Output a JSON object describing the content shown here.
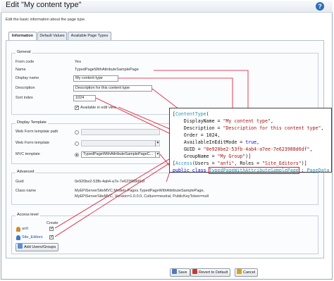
{
  "header": {
    "title": "Edit \"My content type\"",
    "help_icon": "?",
    "description": "Edit the basic information about the page type."
  },
  "tabs": [
    {
      "label": "Information",
      "active": true
    },
    {
      "label": "Default Values",
      "active": false
    },
    {
      "label": "Available Page Types",
      "active": false
    }
  ],
  "general": {
    "legend": "General",
    "from_code_label": "From code",
    "from_code_value": "Yes",
    "name_label": "Name",
    "name_value": "TypedPageWithAttributeSamplePage",
    "display_name_label": "Display name",
    "display_name_value": "My content type",
    "description_label": "Description",
    "description_value": "Description for this content type",
    "sort_index_label": "Sort index",
    "sort_index_value": "1024",
    "available_label": "Available in edit view",
    "available_checked": true
  },
  "display_template": {
    "legend": "Display Template",
    "web_form_path_label": "Web Form template path",
    "web_form_label": "Web Form template",
    "mvc_label": "MVC template",
    "mvc_value": "TypedPageWithAttributeSamplePageC..."
  },
  "advanced": {
    "legend": "Advanced",
    "guid_label": "Guid",
    "guid_value": "0e920be2-53fb-4ab4-a7e-7e623988d6df",
    "class_label": "Class name",
    "class_value_1": "MyEPiServerSiteMVC.Models.Pages.TypedPageWithAttributeSamplePage,",
    "class_value_2": "MyEPiServerSiteMVC, Version=1.0.0.0, Culture=neutral, PublicKeyToken=null"
  },
  "access": {
    "legend": "Access level",
    "create_header": "Create",
    "users": [
      {
        "name": "anfi",
        "checked": true,
        "icon": "user-icon"
      },
      {
        "name": "Site_Editors",
        "checked": true,
        "icon": "group-icon"
      }
    ],
    "add_button": "Add Users/Groups"
  },
  "footer": {
    "save": "Save",
    "revert": "Revert to Default",
    "cancel": "Cancel"
  },
  "code": {
    "line1_open": "[",
    "line1_type": "ContentType",
    "line1_paren": "(",
    "line2_pre": "    DisplayName = ",
    "line2_str": "\"My content type\"",
    "line2_post": ",",
    "line3_pre": "    Description = ",
    "line3_str": "\"Description for this content type\"",
    "line3_post": ",",
    "line4": "    Order = 1024,",
    "line5_pre": "    AvailableInEditMode = ",
    "line5_kw": "true",
    "line5_post": ",",
    "line6_pre": "    GUID = ",
    "line6_str": "\"0e920be2-53fb-4ab4-a7ee-7e623988d6df\"",
    "line6_post": ",",
    "line7_pre": "    GroupName = ",
    "line7_str": "\"My Group\"",
    "line7_post": ")]",
    "line8_open": "[",
    "line8_attr": "Access",
    "line8_pre": "(Users = ",
    "line8_s1": "\"anfi\"",
    "line8_mid": ", Roles = ",
    "line8_s2": "\"Site_Editors\"",
    "line8_post": ")]",
    "line9_kw": "public class ",
    "line9_cls": "TypedPageWithAttributeSamplePage",
    "line9_colon": " : ",
    "line9_base": "PageData"
  },
  "colors": {
    "leader_line": "#e0102a",
    "keyword": "#0000ff",
    "type": "#2b91af",
    "string": "#a31515"
  }
}
